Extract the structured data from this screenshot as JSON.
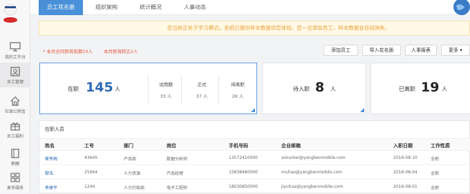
{
  "sidebar": {
    "items": [
      {
        "label": "我的工作台",
        "icon": "monitor-icon"
      },
      {
        "label": "员工管理",
        "icon": "id-card-icon"
      },
      {
        "label": "社保公积金",
        "icon": "house-icon"
      },
      {
        "label": "员工福利",
        "icon": "gift-icon"
      },
      {
        "label": "薪酬",
        "icon": "book-icon"
      },
      {
        "label": "更多服务",
        "icon": "grid-icon"
      }
    ]
  },
  "tabs": [
    "员工花名册",
    "组织架构",
    "统计概况",
    "人事动态"
  ],
  "notice": "您当前正处于学习模式，系统已提供样本数据供您体验。您一旦添加员工，样本数据会自动消失。",
  "reminders": [
    "* 本月合同即将到期10人",
    "本月即将转正2人"
  ],
  "actions": {
    "add_employee": "添加员工",
    "import_roster": "导入花名册",
    "hr_report": "人事报表",
    "more": "更多"
  },
  "cards": {
    "active": {
      "label": "在职",
      "count": "145",
      "unit": "人",
      "subs": [
        {
          "label": "试用期",
          "value": "33 人"
        },
        {
          "label": "正式",
          "value": "37 人"
        },
        {
          "label": "待离职",
          "value": "26 人"
        }
      ]
    },
    "pending": {
      "label": "待入职",
      "count": "8",
      "unit": "人"
    },
    "left": {
      "label": "已离职",
      "count": "19",
      "unit": "人"
    }
  },
  "table": {
    "title": "在职人员",
    "headers": [
      "姓名",
      "工号",
      "部门",
      "岗位",
      "手机号码",
      "企业邮箱",
      "入职日期",
      "工作性质"
    ],
    "rows": [
      [
        "崔秀梅",
        "43645",
        "产品部",
        "数据分析师",
        "13572410000",
        "aixiumei@yangbenmobile.com",
        "2016-08-10",
        "全职"
      ],
      [
        "穆浩",
        "25664",
        "人力资源",
        "产品经理",
        "15838480000",
        "muhao@yangbenmobile.com",
        "2016-08-04",
        "全职"
      ],
      [
        "季建平",
        "1244",
        "人力行政部",
        "电子工程师",
        "18030850000",
        "jiyuhua@yangbenmobile.com",
        "2016-08-01",
        "全职"
      ]
    ]
  },
  "colors": {
    "accent": "#4a90d9",
    "warning": "#e8a13a",
    "alert": "#e65a3c",
    "link": "#2e6ab5"
  }
}
